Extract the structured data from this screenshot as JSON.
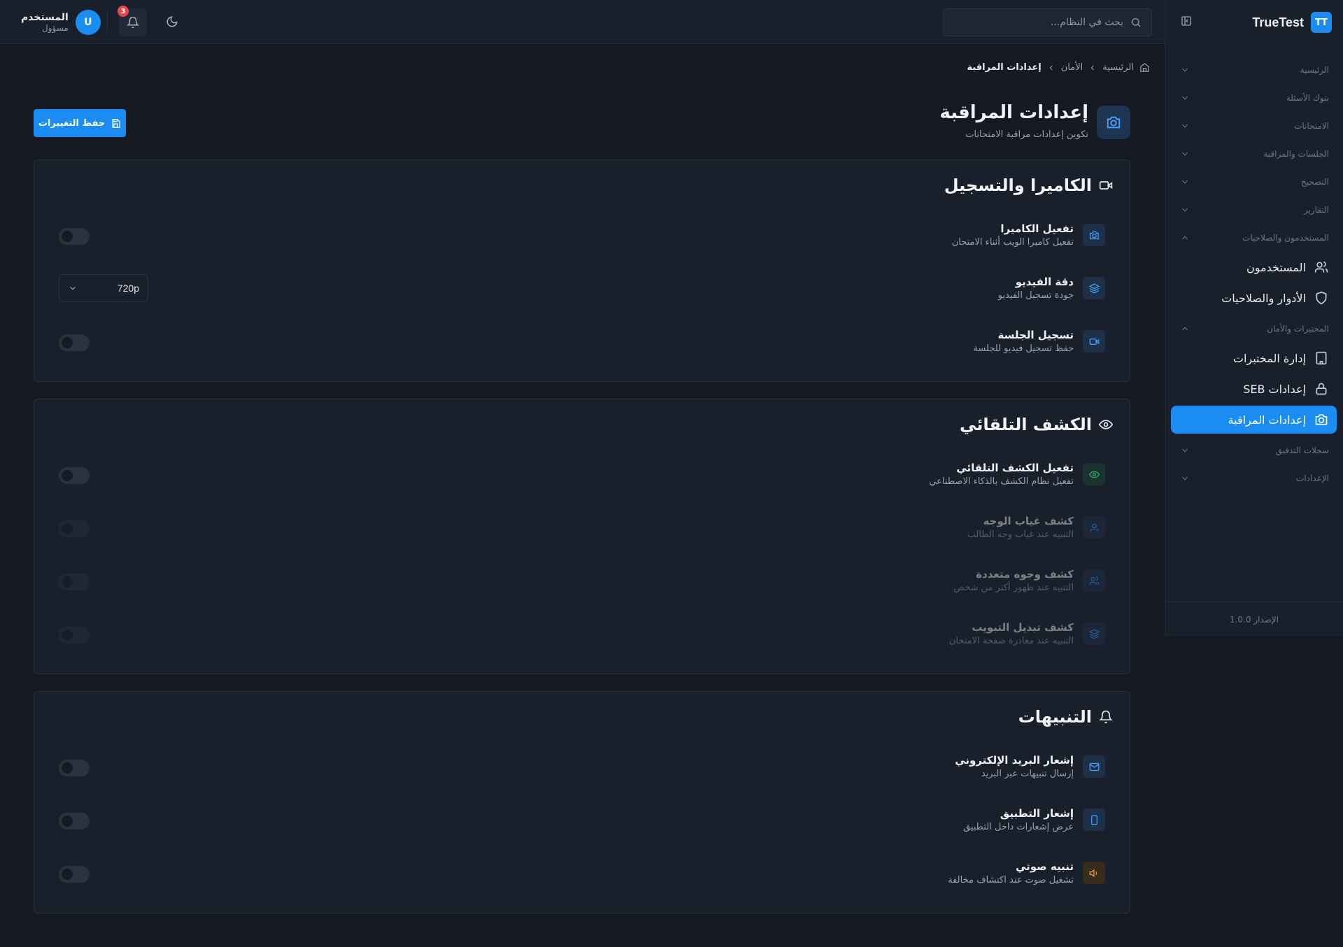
{
  "colors": {
    "accent": "#1b8cf2",
    "background": "#141922",
    "surface": "#1a202b",
    "notification": "#e5484d"
  },
  "sidebar": {
    "brand_badge": "TT",
    "brand_name": "TrueTest",
    "sections": {
      "home": "الرئيسية",
      "question_banks": "بنوك الأسئلة",
      "exams": "الامتحانات",
      "sessions": "الجلسات والمراقبة",
      "grading": "التصحيح",
      "reports": "التقارير",
      "users_perms": "المستخدمون والصلاحيات",
      "labs_security": "المختبرات والأمان",
      "audit_logs": "سجلات التدقيق",
      "settings": "الإعدادات"
    },
    "items": {
      "users": "المستخدمون",
      "roles": "الأدوار والصلاحيات",
      "labs": "إدارة المختبرات",
      "seb": "إعدادات SEB",
      "proctoring": "إعدادات المراقبة"
    },
    "version": "الإصدار 1.0.0"
  },
  "topbar": {
    "search_placeholder": "بحث في النظام...",
    "notifications_count": "3",
    "user_initial": "U",
    "user_name": "المستخدم",
    "user_role": "مسؤول"
  },
  "breadcrumb": {
    "home": "الرئيسية",
    "security": "الأمان",
    "current": "إعدادات المراقبة"
  },
  "page": {
    "title": "إعدادات المراقبة",
    "subtitle": "تكوين إعدادات مراقبة الامتحانات",
    "save_label": "حفظ التغييرات"
  },
  "camera": {
    "title": "الكاميرا والتسجيل",
    "enable_camera": {
      "title": "تفعيل الكاميرا",
      "desc": "تفعيل كاميرا الويب أثناء الامتحان"
    },
    "video_quality": {
      "title": "دقة الفيديو",
      "desc": "جودة تسجيل الفيديو",
      "value": "720p"
    },
    "session_recording": {
      "title": "تسجيل الجلسة",
      "desc": "حفظ تسجيل فيديو للجلسة"
    }
  },
  "auto_detection": {
    "title": "الكشف التلقائي",
    "enable": {
      "title": "تفعيل الكشف التلقائي",
      "desc": "تفعيل نظام الكشف بالذكاء الاصطناعي"
    },
    "face_absence": {
      "title": "كشف غياب الوجه",
      "desc": "التنبيه عند غياب وجه الطالب"
    },
    "multiple_faces": {
      "title": "كشف وجوه متعددة",
      "desc": "التنبيه عند ظهور أكثر من شخص"
    },
    "tab_switch": {
      "title": "كشف تبديل التبويب",
      "desc": "التنبيه عند مغادرة صفحة الامتحان"
    }
  },
  "alerts": {
    "title": "التنبيهات",
    "email": {
      "title": "إشعار البريد الإلكتروني",
      "desc": "إرسال تنبيهات عبر البريد"
    },
    "app": {
      "title": "إشعار التطبيق",
      "desc": "عرض إشعارات داخل التطبيق"
    },
    "sound": {
      "title": "تنبيه صوتي",
      "desc": "تشغيل صوت عند اكتشاف مخالفة"
    }
  },
  "toggles_state": "all-off"
}
